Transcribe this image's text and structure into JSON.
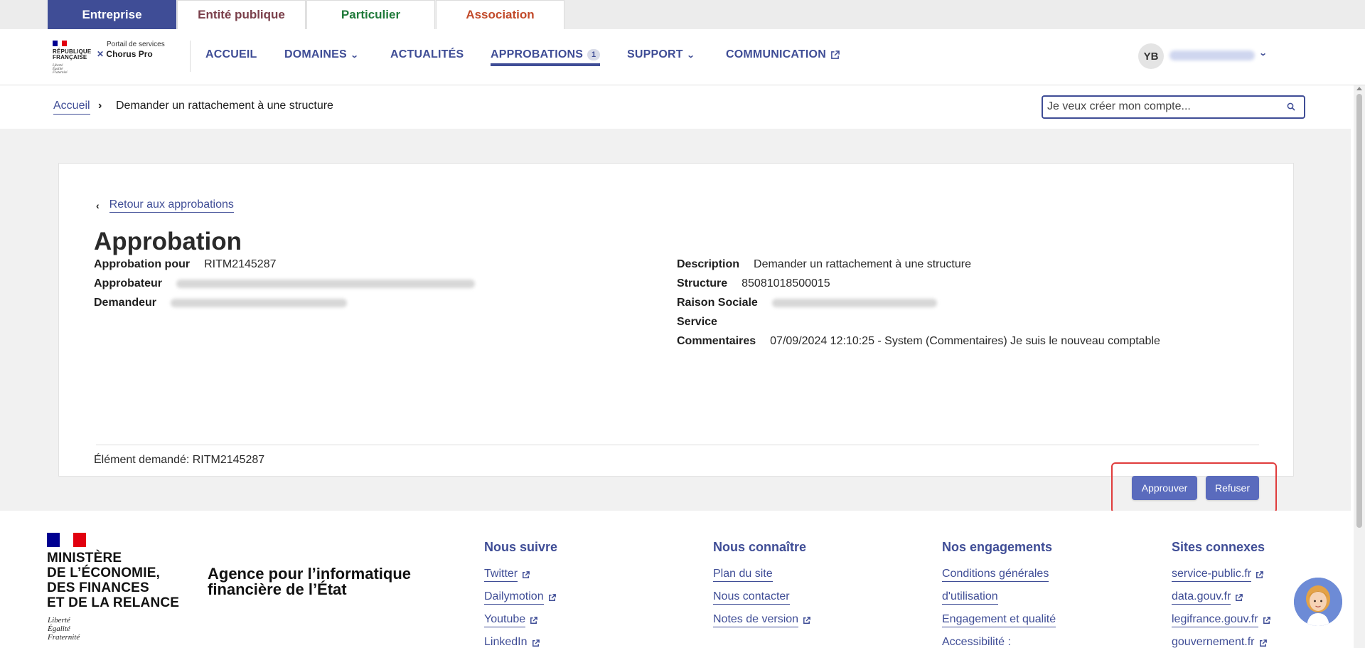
{
  "audience_tabs": [
    {
      "label": "Entreprise",
      "color": "#ffffff",
      "active": true
    },
    {
      "label": "Entité publique",
      "color": "#7a3f4a"
    },
    {
      "label": "Particulier",
      "color": "#1f7a3a"
    },
    {
      "label": "Association",
      "color": "#c24a2a"
    }
  ],
  "brand": {
    "republic": [
      "RÉPUBLIQUE",
      "FRANÇAISE"
    ],
    "motto": [
      "Liberté",
      "Égalité",
      "Fraternité"
    ],
    "portal_label": "Portail de services",
    "product": "Chorus Pro"
  },
  "nav": {
    "home": "ACCUEIL",
    "domains": "DOMAINES",
    "news": "ACTUALITÉS",
    "approvals": "APPROBATIONS",
    "approvals_count": "1",
    "support": "SUPPORT",
    "communication": "COMMUNICATION"
  },
  "user": {
    "initials": "YB"
  },
  "breadcrumb": {
    "home": "Accueil",
    "separator": "›",
    "current": "Demander un rattachement à une structure"
  },
  "search": {
    "placeholder": "Je veux créer mon compte..."
  },
  "approval": {
    "back_label": "Retour aux approbations",
    "title": "Approbation",
    "left_fields": {
      "for_label": "Approbation pour",
      "for_value": "RITM2145287",
      "approver_label": "Approbateur",
      "requester_label": "Demandeur"
    },
    "right_fields": {
      "description_label": "Description",
      "description_value": "Demander un rattachement à une structure",
      "structure_label": "Structure",
      "structure_value": "85081018500015",
      "company_label": "Raison Sociale",
      "service_label": "Service",
      "comments_label": "Commentaires",
      "comments_value": "07/09/2024 12:10:25 - System (Commentaires) Je suis le nouveau comptable"
    },
    "requested_item": "Élément demandé: RITM2145287",
    "approve_label": "Approuver",
    "reject_label": "Refuser"
  },
  "footer": {
    "ministry": [
      "MINISTÈRE",
      "DE L’ÉCONOMIE,",
      "DES FINANCES",
      "ET DE LA RELANCE"
    ],
    "ministry_motto": [
      "Liberté",
      "Égalité",
      "Fraternité"
    ],
    "agency": [
      "Agence pour l’informatique",
      "financière de l’État"
    ],
    "columns": [
      {
        "title": "Nous suivre",
        "links": [
          "Twitter",
          "Dailymotion",
          "Youtube",
          "LinkedIn"
        ]
      },
      {
        "title": "Nous connaître",
        "links": [
          "Plan du site",
          "Nous contacter",
          "Notes de version"
        ]
      },
      {
        "title": "Nos engagements",
        "links": [
          "Conditions générales",
          "d'utilisation",
          "Engagement et qualité",
          "Accessibilité :"
        ]
      },
      {
        "title": "Sites connexes",
        "links": [
          "service-public.fr",
          "data.gouv.fr",
          "legifrance.gouv.fr",
          "gouvernement.fr"
        ]
      }
    ]
  },
  "colors": {
    "primary": "#3f4d96",
    "button": "#5a6bbd",
    "highlight_frame": "#e03c3c",
    "page_bg": "#f1f1f1"
  }
}
